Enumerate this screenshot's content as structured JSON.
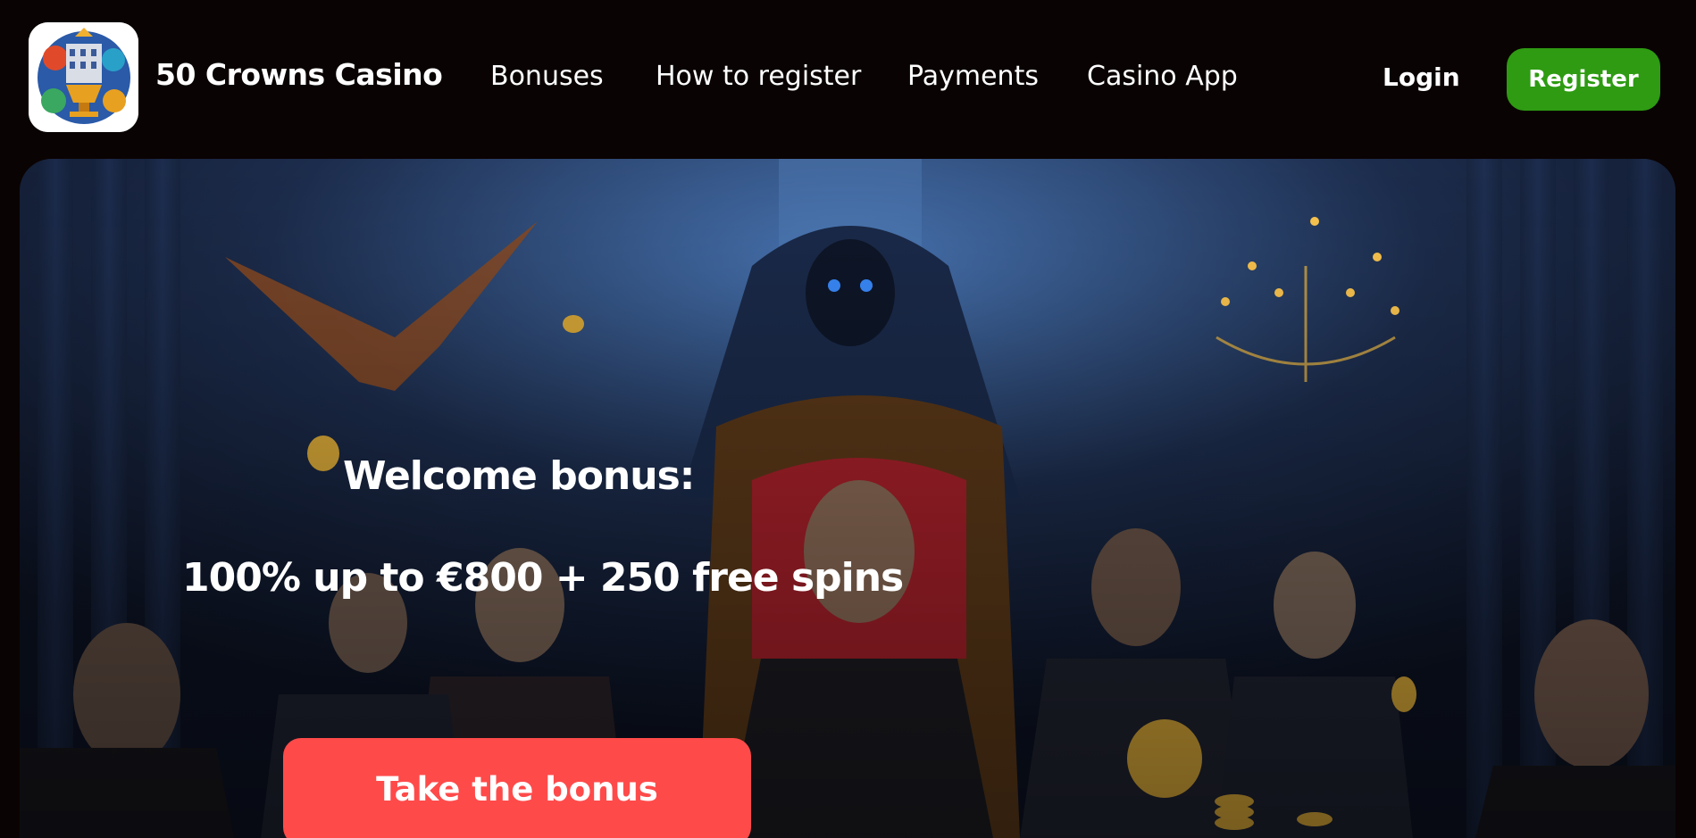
{
  "header": {
    "logo_icon": "casino-crest-icon",
    "brand_name": "50 Crowns Casino",
    "nav": [
      "Bonuses",
      "How to register",
      "Payments",
      "Casino App"
    ],
    "login_label": "Login",
    "register_label": "Register"
  },
  "hero": {
    "title": "Welcome bonus:",
    "offer": "100% up to €800 + 250 free spins",
    "cta_label": "Take the bonus",
    "background_image": "dark fantasy casino scene"
  },
  "colors": {
    "page_bg": "#0a0303",
    "register_bg": "#2e9b12",
    "cta_bg": "#ff4a4a",
    "text": "#ffffff"
  }
}
